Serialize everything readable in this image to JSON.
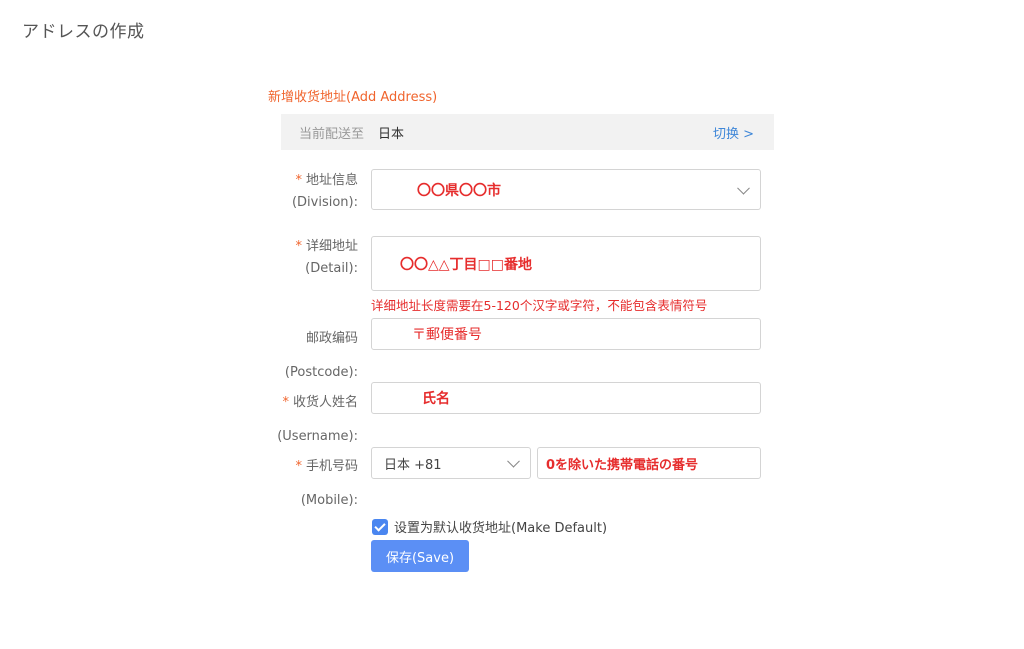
{
  "page": {
    "title": "アドレスの作成"
  },
  "form": {
    "title": "新增收货地址(Add Address)",
    "ship_to": {
      "label": "当前配送至",
      "value": "日本",
      "switch_label": "切换 >"
    },
    "division": {
      "required": "*",
      "label_cn": "地址信息",
      "label_en": "(Division):",
      "value": "〇〇県〇〇市"
    },
    "detail": {
      "required": "*",
      "label_cn": "详细地址",
      "label_en": "(Detail):",
      "value": "〇〇△△丁目□□番地",
      "error": "详细地址长度需要在5-120个汉字或字符，不能包含表情符号"
    },
    "postcode": {
      "label_cn": "邮政编码",
      "label_en": "(Postcode):",
      "value": "〒郵便番号"
    },
    "username": {
      "required": "*",
      "label_cn": "收货人姓名",
      "label_en": "(Username):",
      "value": "氏名"
    },
    "mobile": {
      "required": "*",
      "label_cn": "手机号码",
      "label_en": "(Mobile):",
      "country_code": "日本 +81",
      "value": "0を除いた携帯電話の番号"
    },
    "make_default": {
      "label": "设置为默认收货地址(Make Default)",
      "checked": true
    },
    "save_label": "保存(Save)"
  },
  "colors": {
    "accent": "#5b8ff5",
    "title_orange": "#f0642d",
    "error_red": "#e62d2d",
    "link_blue": "#3f87d8"
  }
}
